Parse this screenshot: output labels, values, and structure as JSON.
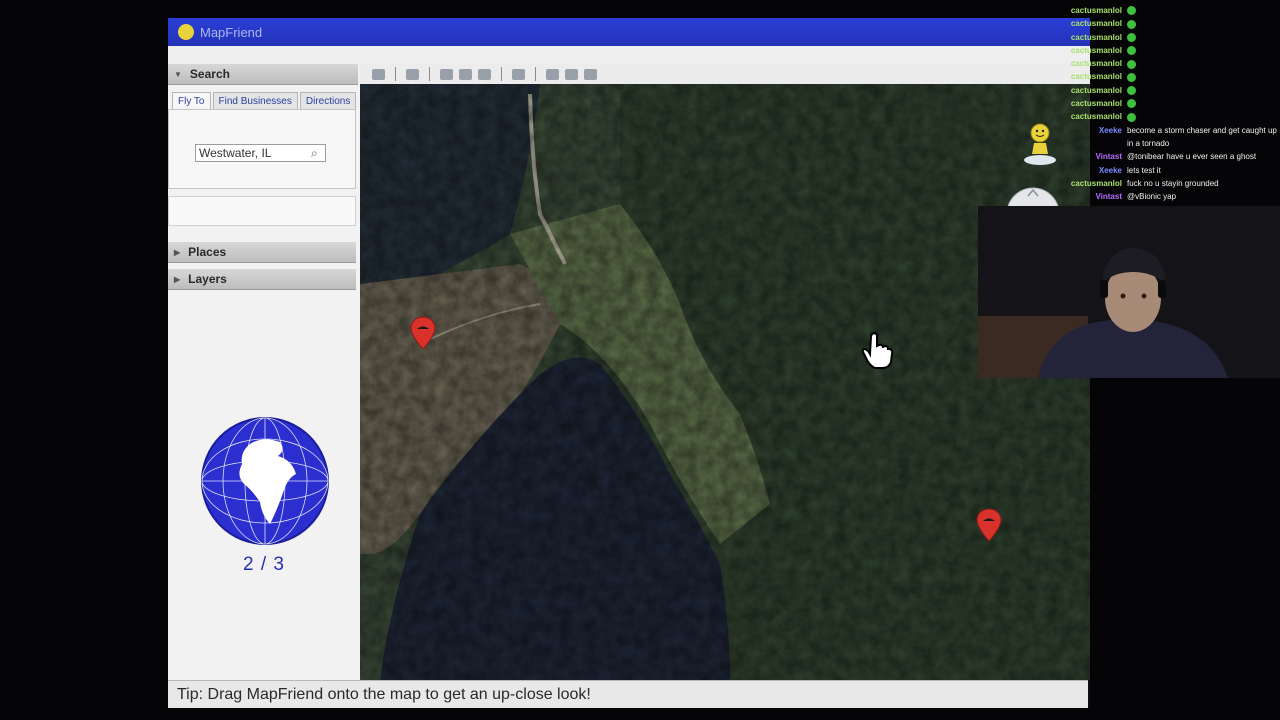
{
  "window": {
    "title": "MapFriend"
  },
  "sidebar": {
    "search_header": "Search",
    "tabs": [
      {
        "label": "Fly To"
      },
      {
        "label": "Find Businesses"
      },
      {
        "label": "Directions"
      }
    ],
    "search_value": "Westwater, IL",
    "places_header": "Places",
    "layers_header": "Layers",
    "progress": "2 / 3"
  },
  "statusbar": {
    "tip": "Tip: Drag MapFriend onto the map to get an up-close look!"
  },
  "chat": [
    {
      "user": "cactusmanlol",
      "color": "#a8e06a",
      "message": "",
      "emote": true
    },
    {
      "user": "cactusmanlol",
      "color": "#a8e06a",
      "message": "",
      "emote": true
    },
    {
      "user": "cactusmanlol",
      "color": "#a8e06a",
      "message": "",
      "emote": true
    },
    {
      "user": "cactusmanlol",
      "color": "#a8e06a",
      "message": "",
      "emote": true
    },
    {
      "user": "cactusmanlol",
      "color": "#a8e06a",
      "message": "",
      "emote": true
    },
    {
      "user": "cactusmanlol",
      "color": "#a8e06a",
      "message": "",
      "emote": true
    },
    {
      "user": "cactusmanlol",
      "color": "#a8e06a",
      "message": "",
      "emote": true
    },
    {
      "user": "cactusmanlol",
      "color": "#a8e06a",
      "message": "",
      "emote": true
    },
    {
      "user": "cactusmanlol",
      "color": "#a8e06a",
      "message": "",
      "emote": true
    },
    {
      "user": "Xeeke",
      "color": "#7b8cff",
      "message": "become a storm chaser and get caught up in a tornado",
      "emote": false
    },
    {
      "user": "Vintast",
      "color": "#b86bff",
      "message": "@tonibear have u ever seen a ghost",
      "emote": false
    },
    {
      "user": "Xeeke",
      "color": "#7b8cff",
      "message": "lets test it",
      "emote": false
    },
    {
      "user": "cactusmanlol",
      "color": "#a8e06a",
      "message": "fuck no u stayin grounded",
      "emote": false
    },
    {
      "user": "Vintast",
      "color": "#b86bff",
      "message": "@vBionic yap",
      "emote": false
    }
  ],
  "colors": {
    "titlebar": "#2b3fd6",
    "pin": "#d9322b",
    "progress_text": "#2730b0"
  },
  "icons": {
    "map_pin": "map-pin-icon",
    "cursor": "hand-cursor-icon",
    "search": "search-icon",
    "globe": "globe-icon"
  }
}
